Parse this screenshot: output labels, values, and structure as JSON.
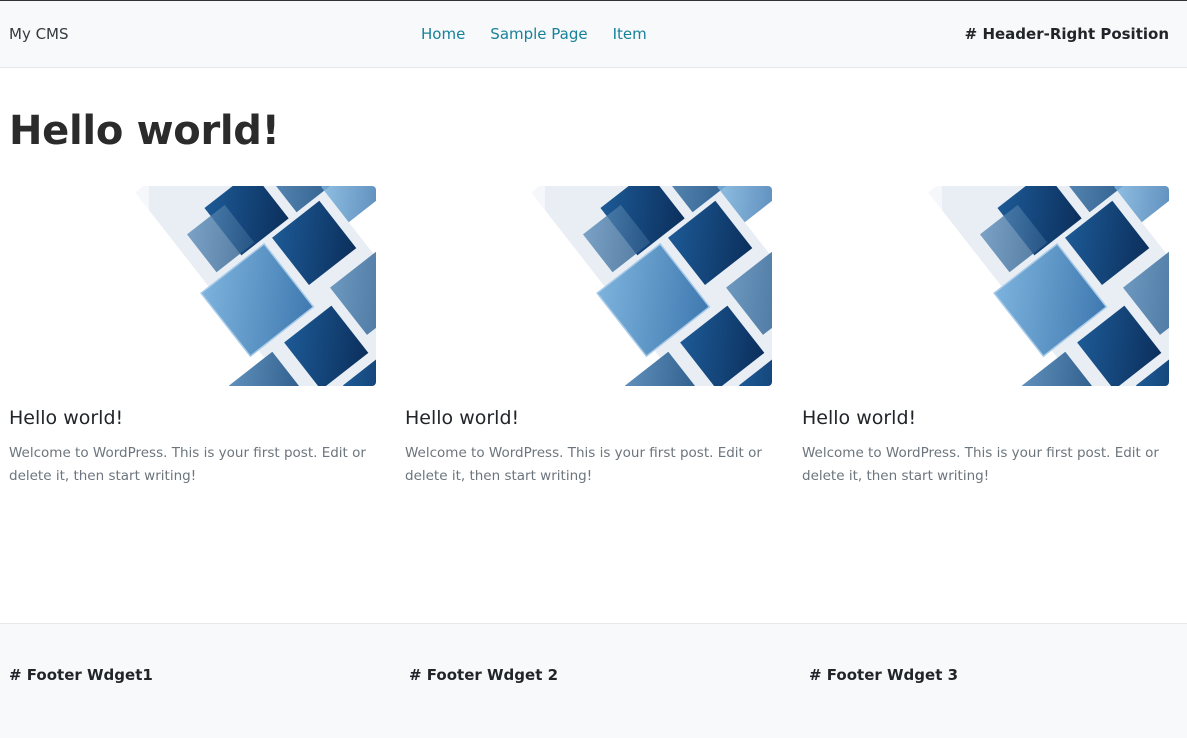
{
  "navbar": {
    "brand": "My CMS",
    "links": [
      {
        "label": "Home"
      },
      {
        "label": "Sample Page"
      },
      {
        "label": "Item"
      }
    ],
    "header_right": "# Header-Right Position"
  },
  "main": {
    "title": "Hello world!",
    "posts": [
      {
        "title": "Hello world!",
        "excerpt": "Welcome to WordPress. This is your first post. Edit or delete it, then start writing!"
      },
      {
        "title": "Hello world!",
        "excerpt": "Welcome to WordPress. This is your first post. Edit or delete it, then start writing!"
      },
      {
        "title": "Hello world!",
        "excerpt": "Welcome to WordPress. This is your first post. Edit or delete it, then start writing!"
      }
    ]
  },
  "footer": {
    "widgets": [
      {
        "title": "# Footer Wdget1"
      },
      {
        "title": "# Footer Wdget 2"
      },
      {
        "title": "# Footer Wdget 3"
      }
    ]
  },
  "colors": {
    "link": "#17819a",
    "navbar_bg": "#f8f9fa",
    "image_blue_dark": "#0d3e73",
    "image_blue_light": "#6fa7d4"
  }
}
